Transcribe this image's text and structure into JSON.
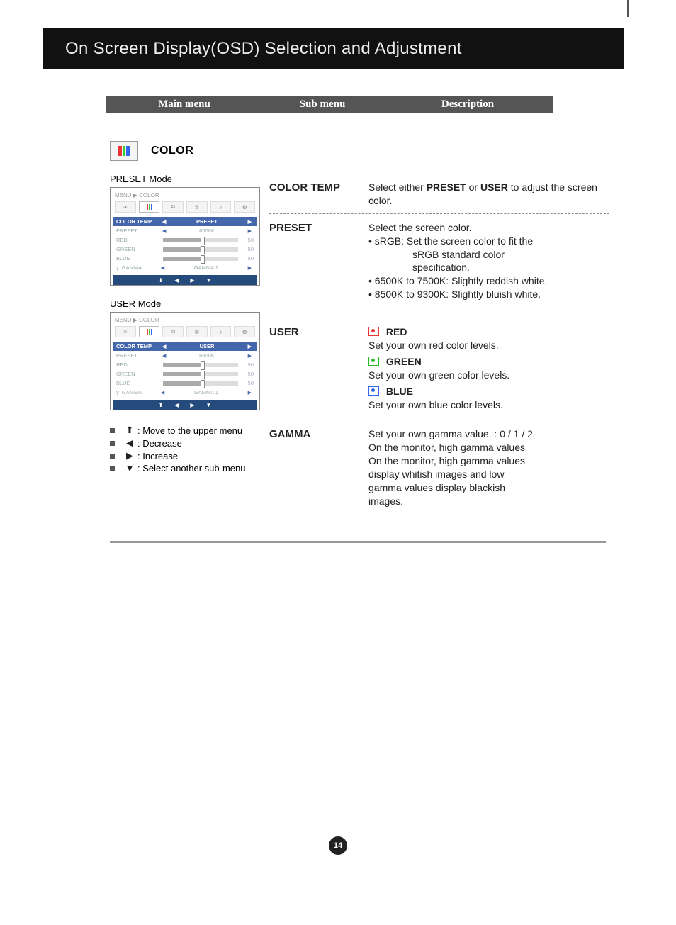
{
  "header": {
    "title": "On Screen Display(OSD) Selection and Adjustment"
  },
  "table_head": {
    "main": "Main menu",
    "sub": "Sub menu",
    "desc": "Description"
  },
  "section_label": "COLOR",
  "modes": {
    "preset_label": "PRESET Mode",
    "user_label": "USER Mode"
  },
  "osd": {
    "breadcrumb": "MENU  ▶  COLOR",
    "preset": {
      "color_temp": "COLOR TEMP",
      "color_temp_val": "PRESET",
      "rows": [
        {
          "label": "PRESET",
          "value": "6500K"
        },
        {
          "label": "RED",
          "value": "50"
        },
        {
          "label": "GREEN",
          "value": "50"
        },
        {
          "label": "BLUE",
          "value": "50"
        }
      ],
      "gamma": "GAMMA",
      "gamma_val": "GAMMA 1"
    },
    "user": {
      "color_temp": "COLOR TEMP",
      "color_temp_val": "USER",
      "rows": [
        {
          "label": "PRESET",
          "value": "6500K"
        },
        {
          "label": "RED",
          "value": "50"
        },
        {
          "label": "GREEN",
          "value": "50"
        },
        {
          "label": "BLUE",
          "value": "50"
        }
      ],
      "gamma": "GAMMA",
      "gamma_val": "GAMMA 1"
    }
  },
  "legend": {
    "up": ": Move to the upper menu",
    "left": ": Decrease",
    "right": ": Increase",
    "down": ": Select another sub-menu"
  },
  "right": {
    "color_temp": {
      "title": "COLOR TEMP",
      "desc_pre": "Select either ",
      "opt1": "PRESET",
      "mid": " or ",
      "opt2": "USER",
      "desc_post": " to adjust the screen color."
    },
    "preset": {
      "title": "PRESET",
      "lead": "Select the screen color.",
      "b1a": "• sRGB: Set the screen color to fit the",
      "b1b": "sRGB standard color",
      "b1c": "specification.",
      "b2": "• 6500K to 7500K: Slightly reddish white.",
      "b3": "• 8500K to 9300K: Slightly bluish white."
    },
    "user": {
      "title": "USER",
      "red": {
        "name": "RED",
        "desc": "Set your own red color levels."
      },
      "green": {
        "name": "GREEN",
        "desc": "Set your own green color levels."
      },
      "blue": {
        "name": "BLUE",
        "desc": "Set your own blue color levels."
      }
    },
    "gamma": {
      "title": "GAMMA",
      "l1": "Set your own gamma value. : 0 / 1 / 2",
      "l2": "On the monitor, high gamma values",
      "l3": "display whitish images and low",
      "l4": "gamma values display blackish",
      "l5": "images."
    }
  },
  "page_number": "14"
}
